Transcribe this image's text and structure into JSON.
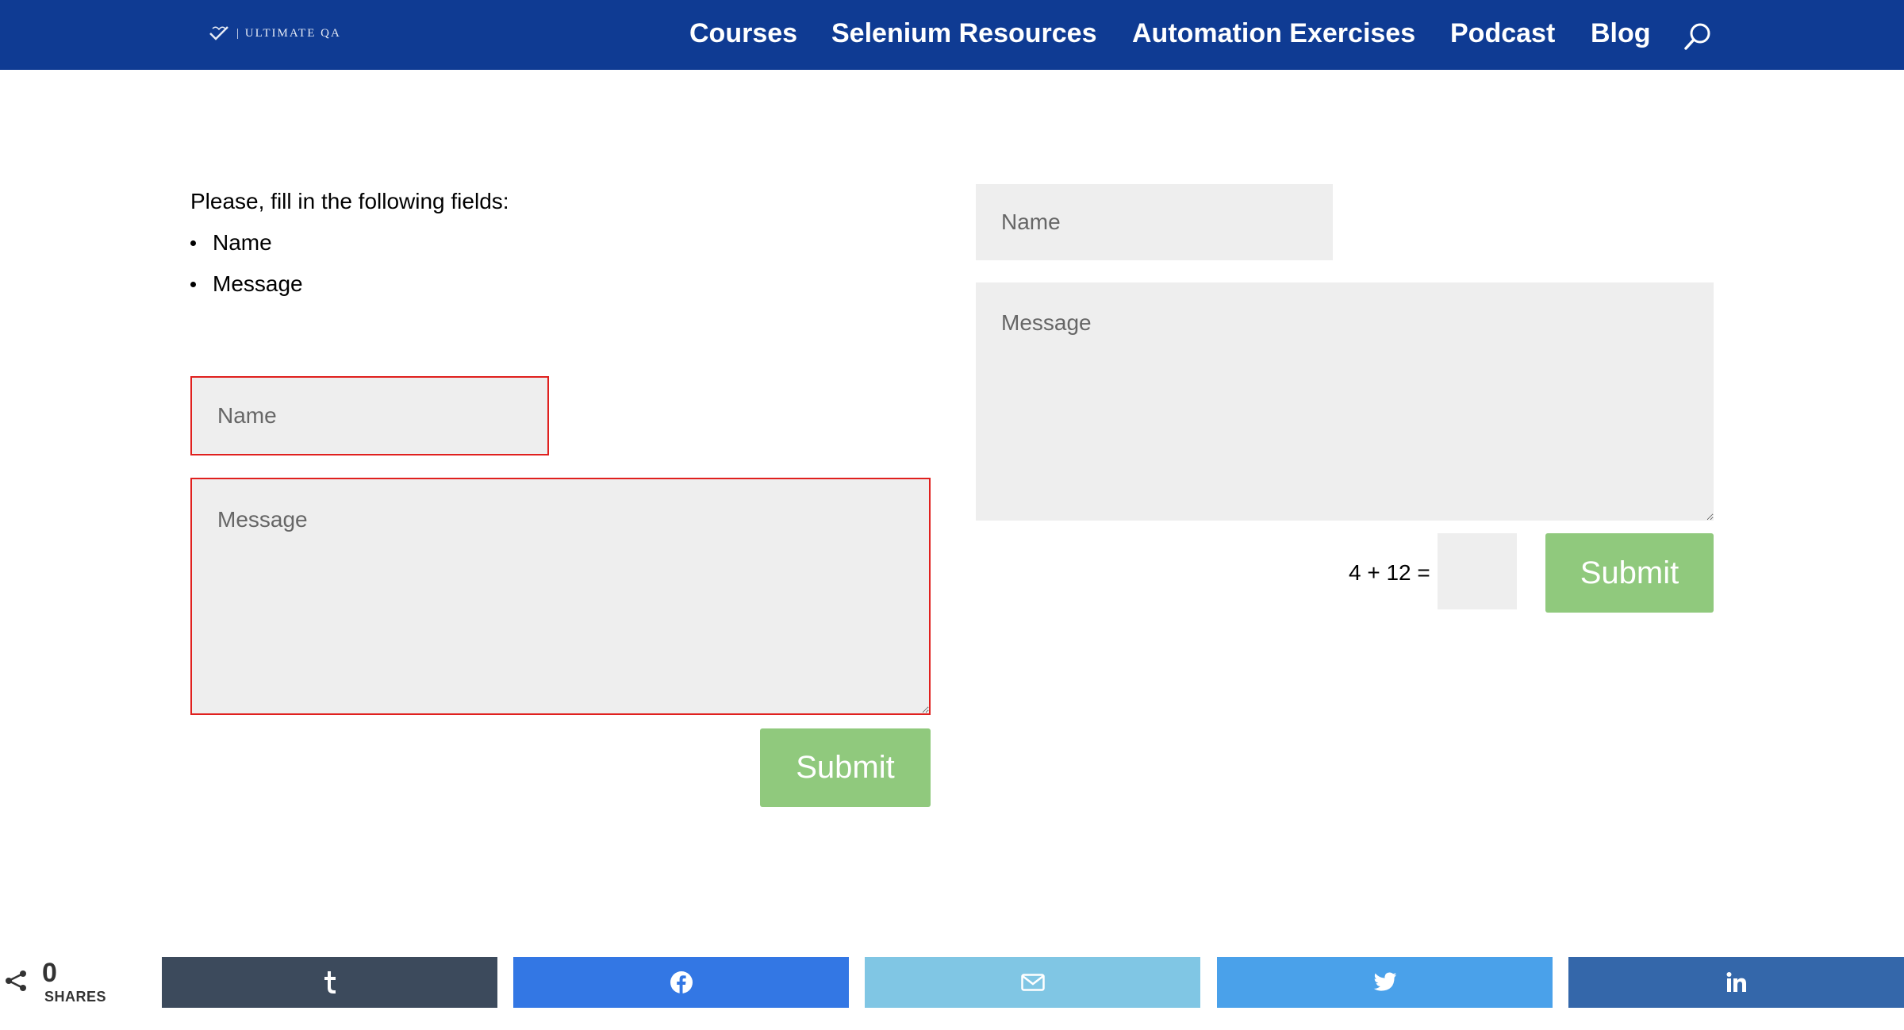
{
  "header": {
    "logo_text": "| ULTIMATE QA",
    "nav": [
      "Courses",
      "Selenium Resources",
      "Automation Exercises",
      "Podcast",
      "Blog"
    ],
    "search_icon": "search-icon",
    "background_color": "#0f3b93"
  },
  "left_form": {
    "intro": "Please, fill in the following fields:",
    "required_fields": [
      "Name",
      "Message"
    ],
    "name_placeholder": "Name",
    "message_placeholder": "Message",
    "submit_label": "Submit",
    "error_border_color": "#e0201e"
  },
  "right_form": {
    "name_placeholder": "Name",
    "message_placeholder": "Message",
    "captcha_question": "4 + 12 =",
    "captcha_value": "",
    "submit_label": "Submit"
  },
  "share_bar": {
    "count": "0",
    "label": "SHARES",
    "buttons": [
      {
        "network": "tumblr",
        "icon": "tumblr-icon",
        "color": "#3c4a5c"
      },
      {
        "network": "facebook",
        "icon": "facebook-icon",
        "color": "#3377e4"
      },
      {
        "network": "email",
        "icon": "email-icon",
        "color": "#80c6e4"
      },
      {
        "network": "twitter",
        "icon": "twitter-icon",
        "color": "#4aa1ea"
      },
      {
        "network": "linkedin",
        "icon": "linkedin-icon",
        "color": "#3467aa"
      }
    ]
  },
  "colors": {
    "submit_button": "#90c97d",
    "field_background": "#eeeeee"
  }
}
